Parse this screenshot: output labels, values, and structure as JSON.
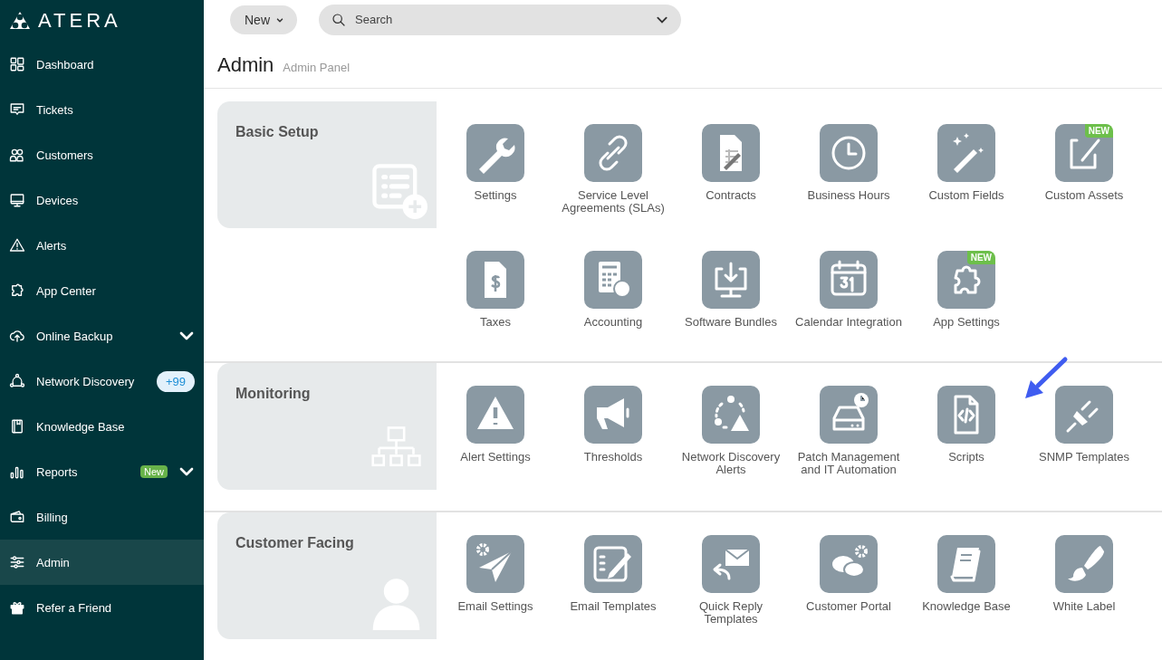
{
  "brand": {
    "name": "ATERA"
  },
  "sidebar": {
    "items": [
      {
        "label": "Dashboard",
        "kind": "link",
        "selected": false
      },
      {
        "label": "Tickets",
        "kind": "link",
        "selected": false
      },
      {
        "label": "Customers",
        "kind": "link",
        "selected": false
      },
      {
        "label": "Devices",
        "kind": "link",
        "selected": false
      },
      {
        "label": "Alerts",
        "kind": "link",
        "selected": false
      },
      {
        "label": "App Center",
        "kind": "link",
        "selected": false
      },
      {
        "label": "Online Backup",
        "kind": "group",
        "selected": false
      },
      {
        "label": "Network Discovery",
        "kind": "link",
        "selected": false,
        "count": "+99"
      },
      {
        "label": "Knowledge Base",
        "kind": "link",
        "selected": false
      },
      {
        "label": "Reports",
        "kind": "group",
        "selected": false,
        "badge": "New"
      },
      {
        "label": "Billing",
        "kind": "link",
        "selected": false
      },
      {
        "label": "Admin",
        "kind": "link",
        "selected": true
      },
      {
        "label": "Refer a Friend",
        "kind": "link",
        "selected": false
      }
    ]
  },
  "topbar": {
    "new_button": "New",
    "search": {
      "placeholder": "Search"
    }
  },
  "header": {
    "title": "Admin",
    "subtitle": "Admin Panel"
  },
  "sections": [
    {
      "title": "Basic Setup",
      "tiles": [
        {
          "label": "Settings"
        },
        {
          "label": "Service Level Agreements (SLAs)"
        },
        {
          "label": "Contracts"
        },
        {
          "label": "Business Hours"
        },
        {
          "label": "Custom Fields"
        },
        {
          "label": "Custom Assets",
          "badge": "NEW"
        },
        {
          "label": "Taxes"
        },
        {
          "label": "Accounting"
        },
        {
          "label": "Software Bundles"
        },
        {
          "label": "Calendar Integration"
        },
        {
          "label": "App Settings",
          "badge": "NEW"
        }
      ]
    },
    {
      "title": "Monitoring",
      "tiles": [
        {
          "label": "Alert Settings"
        },
        {
          "label": "Thresholds"
        },
        {
          "label": "Network Discovery Alerts"
        },
        {
          "label": "Patch Management and IT Automation"
        },
        {
          "label": "Scripts"
        },
        {
          "label": "SNMP Templates"
        }
      ]
    },
    {
      "title": "Customer Facing",
      "tiles": [
        {
          "label": "Email Settings"
        },
        {
          "label": "Email Templates"
        },
        {
          "label": "Quick Reply Templates"
        },
        {
          "label": "Customer Portal"
        },
        {
          "label": "Knowledge Base"
        },
        {
          "label": "White Label"
        }
      ]
    }
  ]
}
